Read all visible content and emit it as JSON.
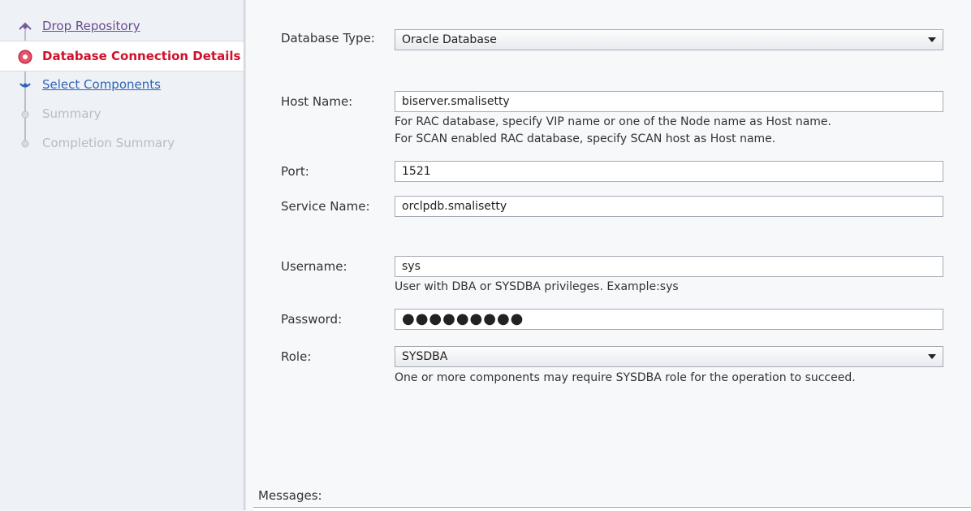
{
  "steps": [
    {
      "label": "Drop Repository",
      "state": "done"
    },
    {
      "label": "Database Connection Details",
      "state": "active"
    },
    {
      "label": "Select Components",
      "state": "link"
    },
    {
      "label": "Summary",
      "state": "disabled"
    },
    {
      "label": "Completion Summary",
      "state": "disabled"
    }
  ],
  "form": {
    "database_type": {
      "label": "Database Type:",
      "value": "Oracle Database"
    },
    "host_name": {
      "label": "Host Name:",
      "value": "biserver.smalisetty",
      "hint1": "For RAC database, specify VIP name or one of the Node name as Host name.",
      "hint2": "For SCAN enabled RAC database, specify SCAN host as Host name."
    },
    "port": {
      "label": "Port:",
      "value": "1521"
    },
    "service_name": {
      "label": "Service Name:",
      "value": "orclpdb.smalisetty"
    },
    "username": {
      "label": "Username:",
      "value": "sys",
      "hint": "User with DBA or SYSDBA privileges. Example:sys"
    },
    "password": {
      "label": "Password:",
      "value": "●●●●●●●●●"
    },
    "role": {
      "label": "Role:",
      "value": "SYSDBA",
      "hint": "One or more components may require SYSDBA role for the operation to succeed."
    }
  },
  "messages_label": "Messages:",
  "colors": {
    "active_step": "#d0112b",
    "link": "#2f63b6",
    "done": "#6b4a8e"
  }
}
